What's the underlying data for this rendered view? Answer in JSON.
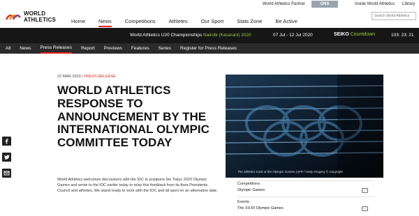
{
  "header": {
    "brand_line1": "WORLD",
    "brand_line2": "ATHLETICS",
    "nav": [
      "Home",
      "News",
      "Competitions",
      "Athletes",
      "Our Sport",
      "Stats Zone",
      "Be Active"
    ],
    "active_nav": "News",
    "partner_label": "World Athletics Partner",
    "partner_logo_text": "ONS",
    "inside_link": "Inside World Athletics",
    "library_link": "Library",
    "search_placeholder": "Search World Athletics"
  },
  "championship_bar": {
    "event": "World Athletics U20 Championships",
    "venue": "Nairobi (Kasarani) 2020",
    "dates": "07 Jul - 12 Jul 2020",
    "sponsor": "SEIKO",
    "countdown_label": "Countdown",
    "countdown_value": "103: 23: 21"
  },
  "section_nav": {
    "items": [
      "All",
      "News",
      "Press Releases",
      "Report",
      "Previews",
      "Features",
      "Series",
      "Register for Press Releases"
    ],
    "active": "Press Releases"
  },
  "article": {
    "date": "22 MAR 2020",
    "separator": " | ",
    "category": "PRESS RELEASE",
    "headline": "World Athletics Response to Announcement by the International Olympic Committee Today",
    "body": "World Athletics welcomes discussions with the IOC to postpone the Tokyo 2020 Olympic Games and wrote to the IOC earlier today to relay this feedback from its Area Presidents, Council and athletes. We stand ready to work with the IOC and all sport on an alternative date."
  },
  "image": {
    "caption": "The athletics track at the Olympic Games (AFP / Getty Images) © Copyright"
  },
  "sidebar": {
    "competitions_label": "Competitions",
    "competitions_value": "Olympic Games",
    "events_label": "Events",
    "events_value": "The XXXII Olympic Games"
  },
  "share_icons": [
    "facebook-icon",
    "twitter-icon",
    "email-icon"
  ],
  "colors": {
    "accent_red": "#e2231a",
    "countdown_green": "#9ccc3c",
    "champ_bar_bg": "#161616",
    "section_nav_bg": "#2b2b2b"
  }
}
